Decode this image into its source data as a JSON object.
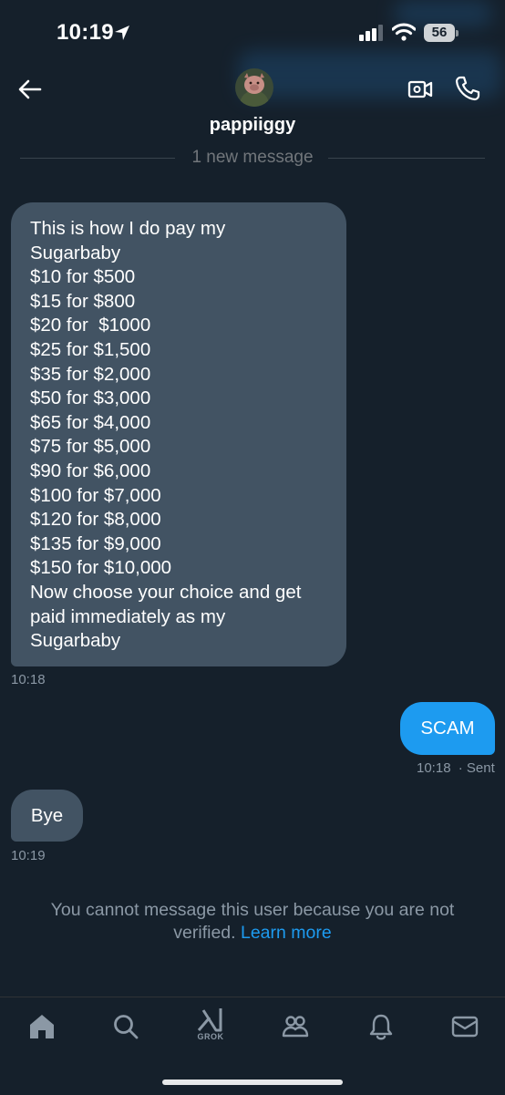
{
  "status_bar": {
    "time": "10:19",
    "battery": "56"
  },
  "header": {
    "username": "pappiiggy",
    "new_message_label": "1 new message"
  },
  "messages": [
    {
      "direction": "incoming",
      "lines": [
        "This is how I do pay my",
        "Sugarbaby",
        "$10 for $500",
        "$15 for $800",
        "$20 for  $1000",
        "$25 for $1,500",
        "$35 for $2,000",
        "$50 for $3,000",
        "$65 for $4,000",
        "$75 for $5,000",
        "$90 for $6,000",
        "$100 for $7,000",
        "$120 for $8,000",
        "$135 for $9,000",
        "$150 for $10,000",
        "Now choose your choice and get",
        "paid immediately as my",
        "Sugarbaby"
      ],
      "time": "10:18"
    },
    {
      "direction": "outgoing",
      "text": "SCAM",
      "time": "10:18",
      "status": "· Sent"
    },
    {
      "direction": "incoming",
      "text": "Bye",
      "time": "10:19"
    }
  ],
  "notice": {
    "text": "You cannot message this user because you are not verified.",
    "link": "Learn more"
  },
  "bottom_nav": {
    "items": [
      {
        "id": "home",
        "icon": "home-icon"
      },
      {
        "id": "search",
        "icon": "search-icon"
      },
      {
        "id": "grok",
        "icon": "grok-icon",
        "label": "GROK"
      },
      {
        "id": "communities",
        "icon": "communities-icon"
      },
      {
        "id": "notifications",
        "icon": "bell-icon"
      },
      {
        "id": "messages",
        "icon": "mail-icon"
      }
    ]
  },
  "colors": {
    "background": "#15202b",
    "incoming_bubble": "#425363",
    "outgoing_bubble": "#1d9bf0",
    "link": "#1d9bf0"
  }
}
